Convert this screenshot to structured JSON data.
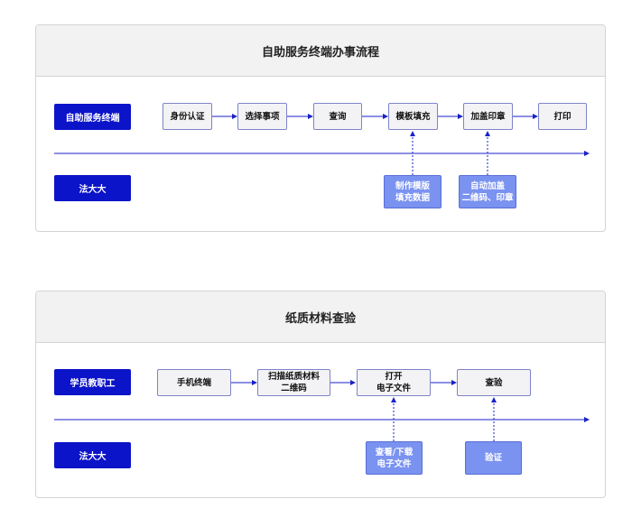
{
  "diagram1": {
    "title": "自助服务终端办事流程",
    "lane_top": "自助服务终端",
    "lane_bottom": "法大大",
    "steps": [
      "身份认证",
      "选择事项",
      "查询",
      "模板填充",
      "加盖印章",
      "打印"
    ],
    "sub_steps": [
      "制作模版\n填充数据",
      "自动加盖\n二维码、印章"
    ]
  },
  "diagram2": {
    "title": "纸质材料查验",
    "lane_top": "学员教职工",
    "lane_bottom": "法大大",
    "steps": [
      "手机终端",
      "扫描纸质材料\n二维码",
      "打开\n电子文件",
      "查验"
    ],
    "sub_steps": [
      "查看/下载\n电子文件",
      "验证"
    ]
  },
  "colors": {
    "lane_label": "#0c14c9",
    "arrow": "#1a22c9",
    "sub_step": "#7a92f0",
    "step_fill": "#f3f3f5"
  }
}
